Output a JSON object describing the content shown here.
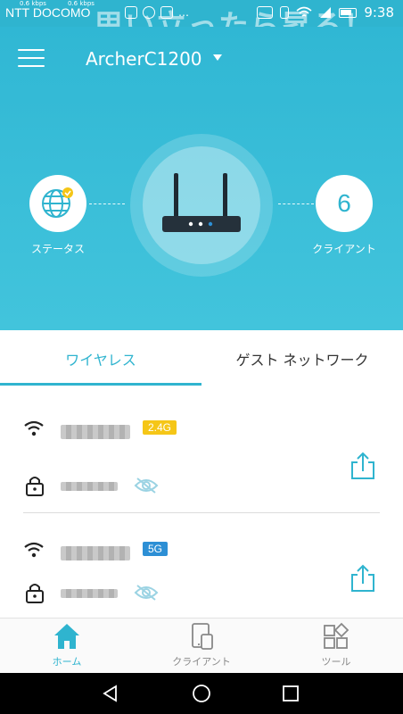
{
  "status_bar": {
    "carrier": "NTT DOCOMO",
    "speed_1": "0.6 kbps",
    "speed_2": "0.6 kbps",
    "time": "9:38",
    "watermark": "思い立ったら昇る！"
  },
  "header": {
    "router_name": "ArcherC1200",
    "status_label": "ステータス",
    "client_count": "6",
    "client_label": "クライアント"
  },
  "tabs": {
    "wireless": "ワイヤレス",
    "guest": "ゲスト ネットワーク"
  },
  "networks": [
    {
      "band": "2.4G",
      "band_color": "#f5c617"
    },
    {
      "band": "5G",
      "band_color": "#2d8fd5"
    }
  ],
  "bottom_nav": {
    "home": "ホーム",
    "clients": "クライアント",
    "tools": "ツール"
  },
  "colors": {
    "accent": "#2fb4cf",
    "header_bg": "#3bbfd9"
  }
}
